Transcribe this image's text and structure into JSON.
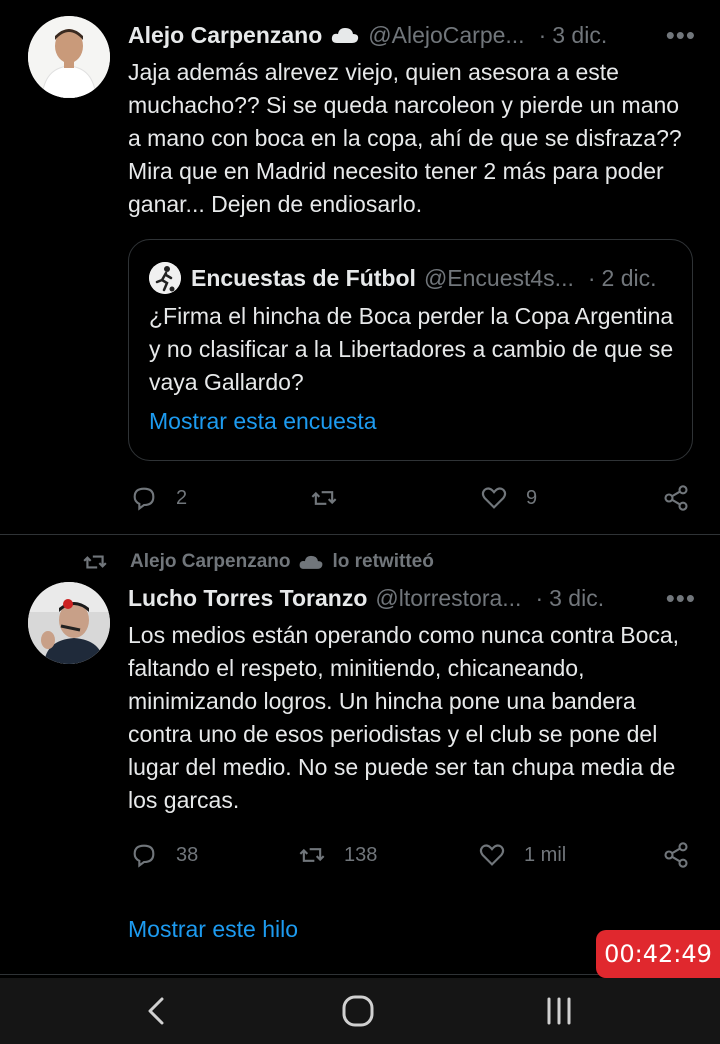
{
  "tweet1": {
    "name": "Alejo Carpenzano",
    "handle": "@AlejoCarpe...",
    "time": "3 dic.",
    "text": "Jaja además alrevez viejo, quien asesora a este muchacho?? Si se queda narcoleon y pierde un mano a mano con boca en la copa, ahí de que se disfraza?? Mira que en Madrid necesito tener 2 más para poder ganar... Dejen de endiosarlo.",
    "quote": {
      "name": "Encuestas de Fútbol",
      "handle": "@Encuest4s...",
      "time": "2 dic.",
      "text": "¿Firma el hincha de Boca perder la Copa Argentina y no clasificar a la Libertadores a cambio de que se vaya Gallardo?",
      "link": "Mostrar esta encuesta"
    },
    "replies": "2",
    "retweets": "",
    "likes": "9"
  },
  "retweet_banner": {
    "name": "Alejo Carpenzano",
    "label": "lo retwitteó"
  },
  "tweet2": {
    "name": "Lucho Torres Toranzo",
    "handle": "@ltorrestora...",
    "time": "3 dic.",
    "text": "Los medios están operando como nunca contra Boca, faltando el respeto, minitiendo, chicaneando, minimizando logros. Un hincha pone una bandera contra uno de esos periodistas y el club se pone del lugar del medio. No se puede ser tan chupa media de los garcas.",
    "replies": "38",
    "retweets": "138",
    "likes": "1 mil"
  },
  "show_thread": "Mostrar este hilo",
  "timer": "00:42:49",
  "colors": {
    "background": "#000000",
    "text": "#e7e9ea",
    "muted": "#71767b",
    "accent": "#1d9bf0",
    "timer_bg": "#e0282e"
  },
  "icons": [
    "cloud-icon",
    "more-icon",
    "reply-icon",
    "retweet-icon",
    "like-icon",
    "share-icon",
    "back-icon",
    "home-icon",
    "recents-icon"
  ]
}
